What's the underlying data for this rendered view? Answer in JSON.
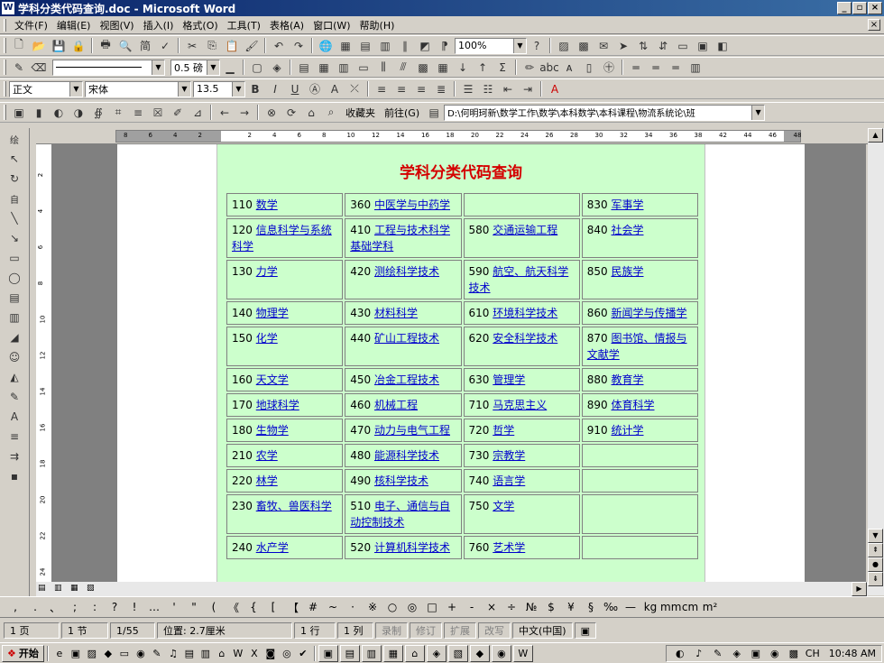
{
  "window": {
    "title": "学科分类代码查询.doc - Microsoft Word",
    "app_icon": "W"
  },
  "menu": [
    "文件(F)",
    "编辑(E)",
    "视图(V)",
    "插入(I)",
    "格式(O)",
    "工具(T)",
    "表格(A)",
    "窗口(W)",
    "帮助(H)"
  ],
  "toolbar1": {
    "zoom": "100%"
  },
  "toolbar2": {
    "line_width": "0.5 磅"
  },
  "format_bar": {
    "style": "正文",
    "font": "宋体",
    "size": "13.5",
    "bold": "B",
    "italic": "I",
    "underline": "U"
  },
  "web_bar": {
    "favorites": "收藏夹",
    "goto": "前往(G)",
    "address": "D:\\何明珂新\\数学工作\\数学\\本科数学\\本科课程\\物流系统论\\班"
  },
  "ruler": {
    "ticks": [
      "8",
      "6",
      "4",
      "2",
      "",
      "2",
      "4",
      "6",
      "8",
      "10",
      "12",
      "14",
      "16",
      "18",
      "20",
      "22",
      "24",
      "26",
      "28",
      "30",
      "32",
      "34",
      "36",
      "38",
      "42",
      "44",
      "46",
      "48"
    ]
  },
  "vruler": {
    "ticks": [
      "2",
      "4",
      "6",
      "8",
      "10",
      "12",
      "14",
      "16",
      "18",
      "20",
      "22",
      "24"
    ]
  },
  "document": {
    "heading": "学科分类代码查询",
    "rows": [
      [
        {
          "code": "110",
          "name": "数学"
        },
        {
          "code": "360",
          "name": "中医学与中药学"
        },
        {
          "code": "",
          "name": ""
        },
        {
          "code": "830",
          "name": "军事学"
        }
      ],
      [
        {
          "code": "120",
          "name": "信息科学与系统科学"
        },
        {
          "code": "410",
          "name": "工程与技术科学基础学科"
        },
        {
          "code": "580",
          "name": "交通运输工程"
        },
        {
          "code": "840",
          "name": "社会学"
        }
      ],
      [
        {
          "code": "130",
          "name": "力学"
        },
        {
          "code": "420",
          "name": "测绘科学技术"
        },
        {
          "code": "590",
          "name": "航空、航天科学技术"
        },
        {
          "code": "850",
          "name": "民族学"
        }
      ],
      [
        {
          "code": "140",
          "name": "物理学"
        },
        {
          "code": "430",
          "name": "材料科学"
        },
        {
          "code": "610",
          "name": "环境科学技术"
        },
        {
          "code": "860",
          "name": "新闻学与传播学"
        }
      ],
      [
        {
          "code": "150",
          "name": "化学"
        },
        {
          "code": "440",
          "name": "矿山工程技术"
        },
        {
          "code": "620",
          "name": "安全科学技术"
        },
        {
          "code": "870",
          "name": "图书馆、情报与文献学"
        }
      ],
      [
        {
          "code": "160",
          "name": "天文学"
        },
        {
          "code": "450",
          "name": "冶金工程技术"
        },
        {
          "code": "630",
          "name": "管理学"
        },
        {
          "code": "880",
          "name": "教育学"
        }
      ],
      [
        {
          "code": "170",
          "name": "地球科学"
        },
        {
          "code": "460",
          "name": "机械工程"
        },
        {
          "code": "710",
          "name": "马克思主义"
        },
        {
          "code": "890",
          "name": "体育科学"
        }
      ],
      [
        {
          "code": "180",
          "name": "生物学"
        },
        {
          "code": "470",
          "name": "动力与电气工程"
        },
        {
          "code": "720",
          "name": "哲学"
        },
        {
          "code": "910",
          "name": "统计学"
        }
      ],
      [
        {
          "code": "210",
          "name": "农学"
        },
        {
          "code": "480",
          "name": "能源科学技术"
        },
        {
          "code": "730",
          "name": "宗教学"
        },
        {
          "code": "",
          "name": ""
        }
      ],
      [
        {
          "code": "220",
          "name": "林学"
        },
        {
          "code": "490",
          "name": "核科学技术"
        },
        {
          "code": "740",
          "name": "语言学"
        },
        {
          "code": "",
          "name": ""
        }
      ],
      [
        {
          "code": "230",
          "name": "畜牧、兽医科学"
        },
        {
          "code": "510",
          "name": "电子、通信与自动控制技术"
        },
        {
          "code": "750",
          "name": "文学"
        },
        {
          "code": "",
          "name": ""
        }
      ],
      [
        {
          "code": "240",
          "name": "水产学"
        },
        {
          "code": "520",
          "name": "计算机科学技术"
        },
        {
          "code": "760",
          "name": "艺术学"
        },
        {
          "code": "",
          "name": ""
        }
      ]
    ]
  },
  "symbols": [
    ",",
    ".",
    "、",
    ";",
    ":",
    "?",
    "!",
    "…",
    "'",
    "\"",
    "(",
    "《",
    "{",
    "[",
    "【",
    "#",
    "~",
    "·",
    "※",
    "○",
    "◎",
    "□",
    "+",
    "-",
    "×",
    "÷",
    "№",
    "$",
    "¥",
    "§",
    "‰",
    "—",
    "kg",
    "mm",
    "cm",
    "m²"
  ],
  "status": {
    "page": "1 页",
    "section": "1 节",
    "pages": "1/55",
    "position": "位置: 2.7厘米",
    "line": "1 行",
    "col": "1 列",
    "rec": "录制",
    "trk": "修订",
    "ext": "扩展",
    "ovr": "改写",
    "lang": "中文(中国)"
  },
  "taskbar": {
    "start": "开始",
    "clock": "10:48 AM"
  }
}
